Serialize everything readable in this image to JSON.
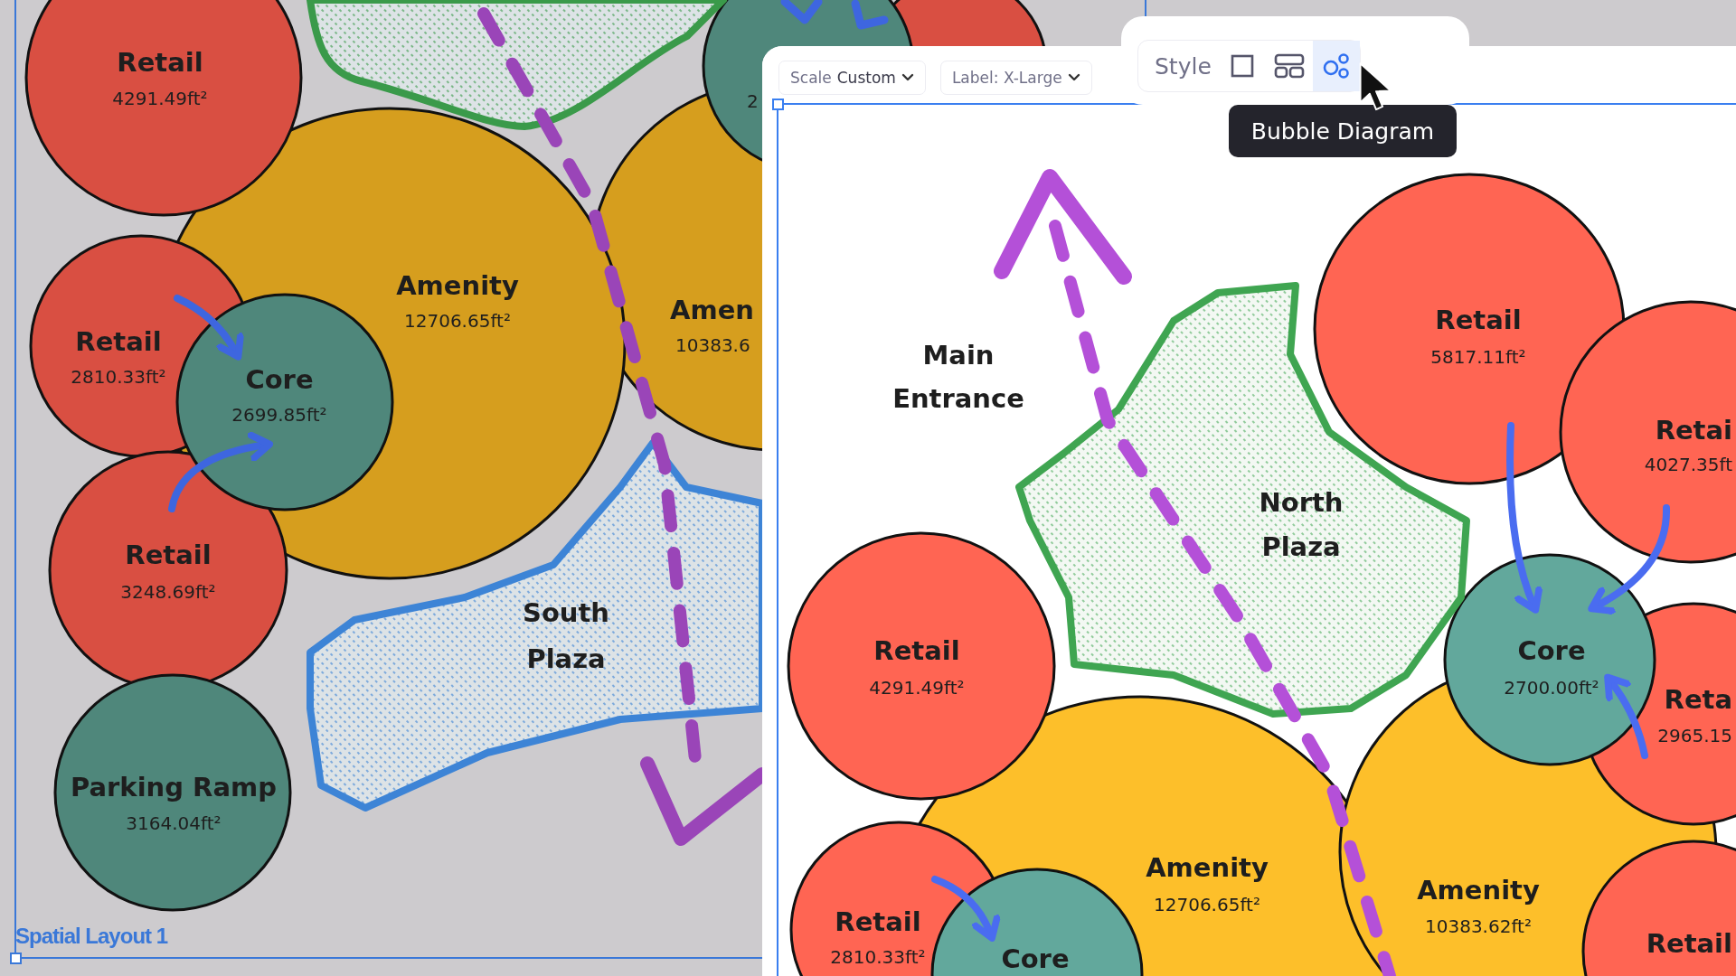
{
  "left_canvas": {
    "dimmed": true,
    "frame_label": "Spatial Layout 1",
    "bubbles": [
      {
        "kind": "retail"
      },
      {
        "kind": "amenity",
        "name": "Amen",
        "area": "10383.6"
      },
      {
        "kind": "core",
        "area": "2"
      },
      {
        "kind": "amenity",
        "name": "Amenity",
        "area": "12706.65ft²"
      },
      {
        "kind": "retail",
        "name": "Retail",
        "area": "4291.49ft²"
      },
      {
        "kind": "retail",
        "name": "Retail",
        "area": "2810.33ft²"
      },
      {
        "kind": "retail",
        "name": "Retail",
        "area": "3248.69ft²"
      },
      {
        "kind": "core",
        "name": "Core",
        "area": "2699.85ft²"
      },
      {
        "kind": "parking",
        "name": "Parking Ramp",
        "area": "3164.04ft²"
      }
    ],
    "plazas": [
      {
        "color": "#3a9a4a"
      },
      {
        "color": "#3d84d6",
        "name": "South Plaza"
      }
    ]
  },
  "editor_panel": {
    "toolbar": {
      "scale": {
        "label": "Scale",
        "value": "Custom"
      },
      "label_size": "Label: X-Large"
    },
    "style_menu": {
      "label": "Style",
      "options": [
        {
          "kind": "frame",
          "selected": false
        },
        {
          "kind": "layout",
          "selected": false
        },
        {
          "kind": "bubble",
          "selected": true
        }
      ],
      "tooltip": "Bubble Diagram"
    },
    "canvas": {
      "dimmed": false,
      "bubbles": [
        {
          "kind": "retail",
          "name": "Retail",
          "area": "5817.11ft²"
        },
        {
          "kind": "retail",
          "name": "Retai",
          "area": "4027.35ft"
        },
        {
          "kind": "amenity",
          "name": "Amenity",
          "area": "12706.65ft²"
        },
        {
          "kind": "retail",
          "name": "Retail",
          "area": "4291.49ft²"
        },
        {
          "kind": "amenity",
          "name": "Amenity",
          "area": "10383.62ft²"
        },
        {
          "kind": "retail",
          "name": "Reta",
          "area": "2965.15"
        },
        {
          "kind": "retail",
          "name": "Retail"
        },
        {
          "kind": "core",
          "name": "Core",
          "area": "2700.00ft²"
        },
        {
          "kind": "retail",
          "name": "Retail",
          "area": "2810.33ft²"
        },
        {
          "kind": "core",
          "name": "Core"
        }
      ],
      "plazas": [
        {
          "color": "#3fa551",
          "name": "North Plaza"
        }
      ],
      "labels": [
        {
          "text": "Main Entrance"
        }
      ]
    }
  }
}
